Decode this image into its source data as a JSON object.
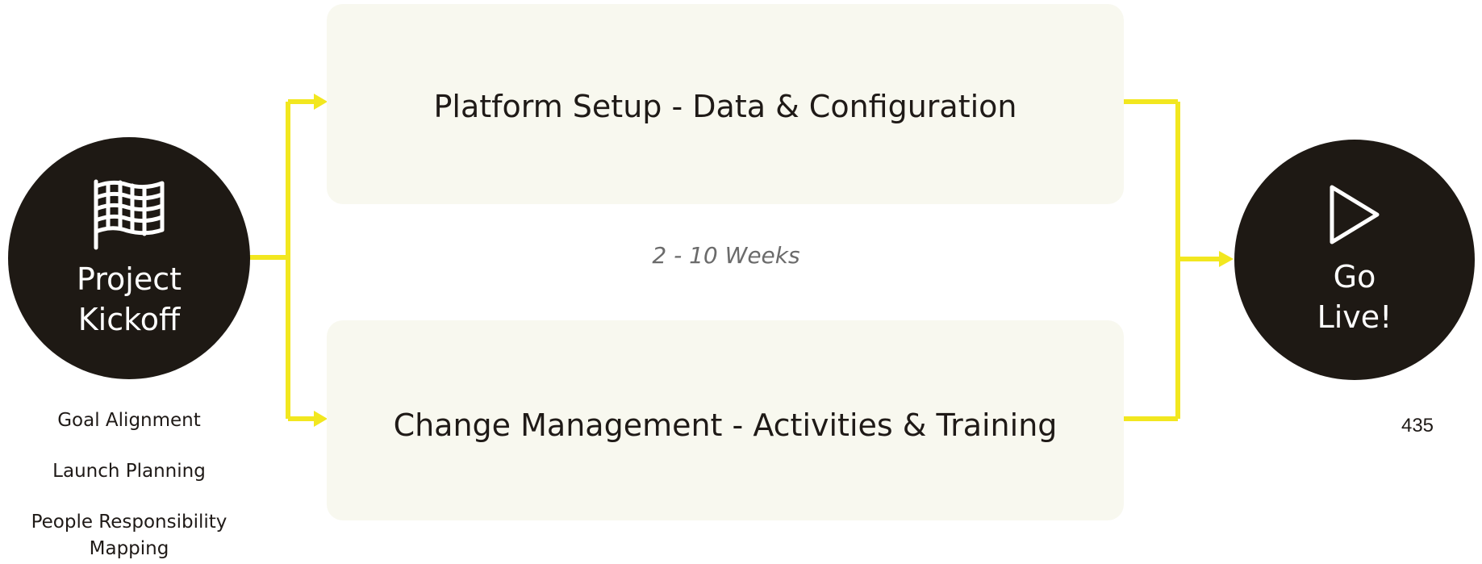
{
  "start": {
    "label": "Project\nKickoff",
    "icon": "flag-icon",
    "tasks": [
      "Goal Alignment",
      "Launch Planning",
      "People Responsibility Mapping"
    ]
  },
  "phases": [
    {
      "title": "Platform Setup - Data & Configuration"
    },
    {
      "title": "Change Management - Activities & Training"
    }
  ],
  "duration": "2 - 10 Weeks",
  "end": {
    "label": "Go\nLive!",
    "icon": "play-icon"
  },
  "page_number": "435",
  "colors": {
    "circle_fill": "#1e1914",
    "phase_box_fill": "#f8f8ef",
    "connector": "#f2e71f",
    "duration_text": "#6b6b6b"
  }
}
